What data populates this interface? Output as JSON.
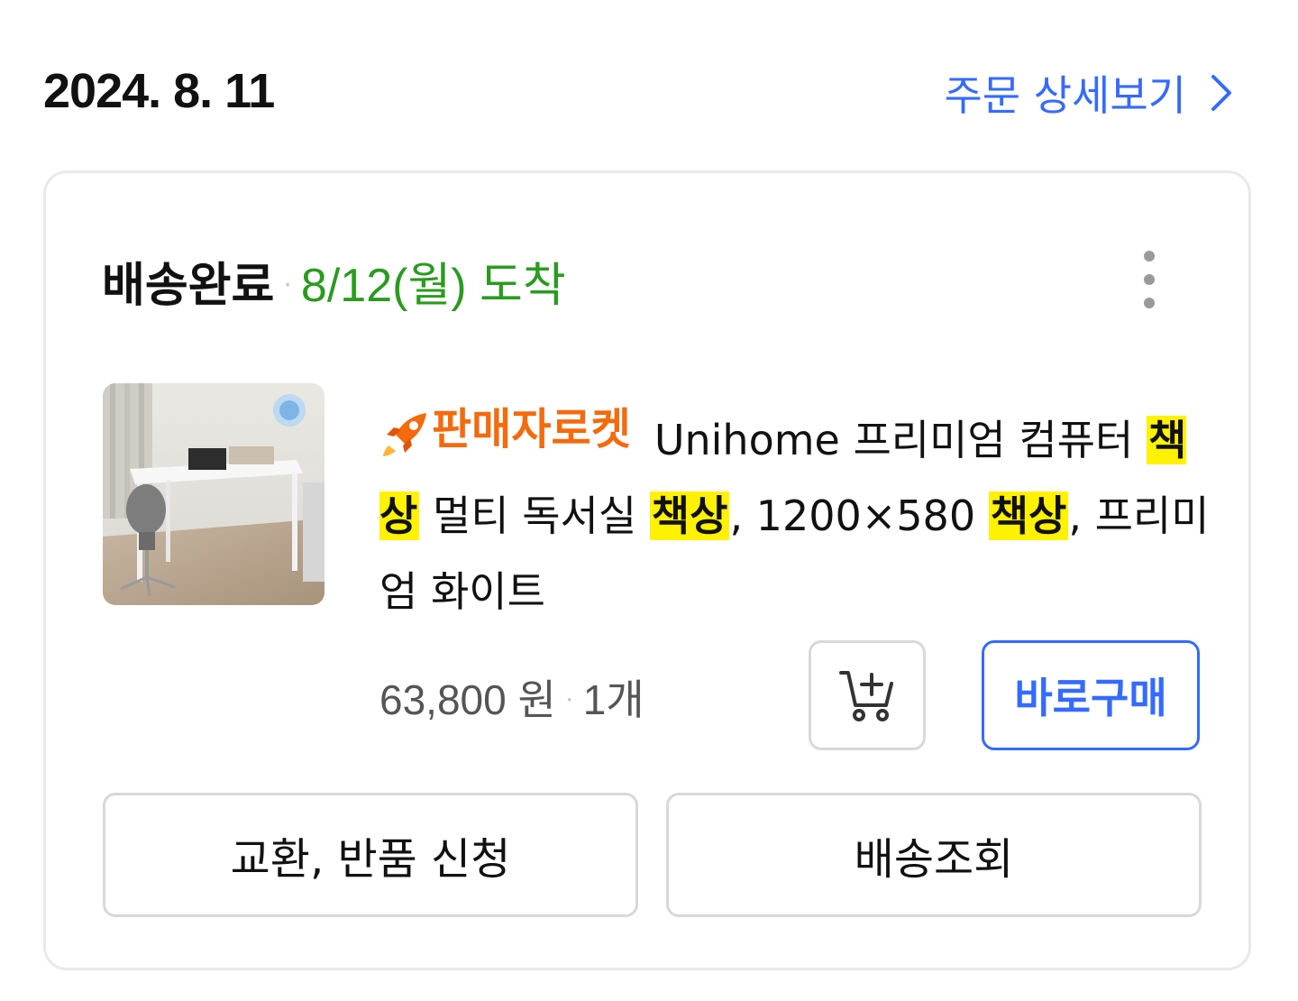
{
  "order": {
    "date": "2024. 8. 11",
    "detail_link_label": "주문 상세보기"
  },
  "shipment": {
    "status": "배송완료",
    "separator": "·",
    "arrival": "8/12(월) 도착"
  },
  "product": {
    "badge_label": "판매자로켓",
    "title_parts": {
      "p1": "Unihome 프리미엄 컴퓨터",
      "h1": "책상",
      "p2": " 멀티 독서실 ",
      "h2": "책상",
      "p3": ", 1200×580 ",
      "h3": "책상",
      "p4": ", 프리미엄 화이트"
    },
    "price": "63,800 원",
    "separator": "·",
    "quantity": "1개"
  },
  "buttons": {
    "buy_now": "바로구매",
    "exchange_return": "교환, 반품 신청",
    "track_delivery": "배송조회"
  },
  "icons": {
    "detail_chevron": "chevron-right-icon",
    "more": "more-vertical-icon",
    "cart": "add-to-cart-icon",
    "rocket": "rocket-icon"
  },
  "colors": {
    "accent_blue": "#346aff",
    "arrival_green": "#2a9b1f",
    "badge_orange": "#f46a0d",
    "highlight_yellow": "#fff200",
    "border_gray": "#d8d8d8"
  }
}
